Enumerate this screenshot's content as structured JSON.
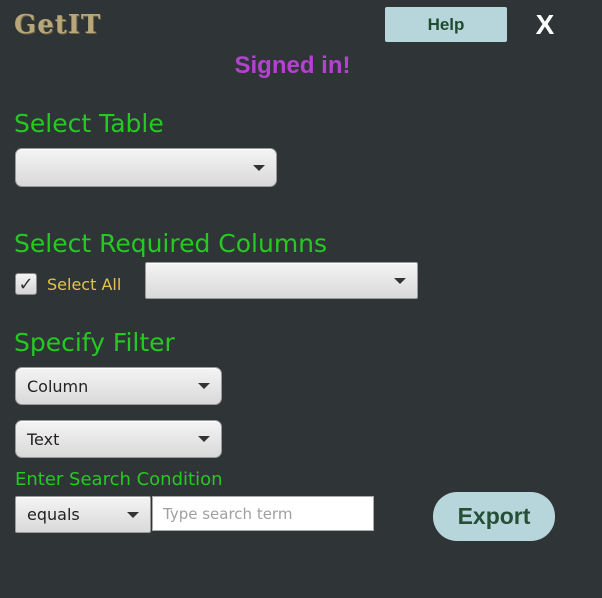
{
  "app": {
    "logo_text": "GetIT",
    "status_text": "Signed in!"
  },
  "header": {
    "help_label": "Help",
    "close_label": "X"
  },
  "select_table": {
    "heading": "Select Table",
    "selected": ""
  },
  "columns": {
    "heading": "Select Required Columns",
    "select_all_label": "Select All",
    "select_all_checked": true,
    "check_glyph": "✓",
    "selected": ""
  },
  "filter": {
    "heading": "Specify Filter",
    "column_selected": "Column",
    "type_selected": "Text",
    "condition_label": "Enter Search Condition",
    "operator_selected": "equals",
    "search_placeholder": "Type search term",
    "search_value": ""
  },
  "actions": {
    "export_label": "Export"
  },
  "colors": {
    "background": "#2f3537",
    "heading_green": "#25c922",
    "status_purple": "#b441d0",
    "button_bg": "#b7d6db",
    "label_yellow": "#e3c44a"
  }
}
